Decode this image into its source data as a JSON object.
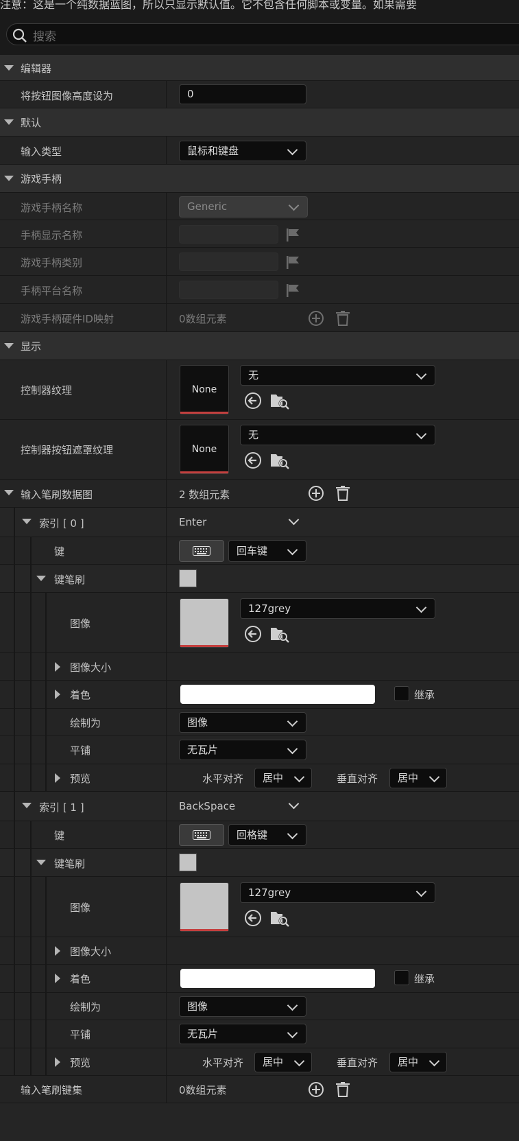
{
  "notice": "注意：这是一个纯数据蓝图，所以只显示默认值。它不包含任何脚本或变量。如果需要",
  "search": {
    "placeholder": "搜索"
  },
  "sections": {
    "editor": "编辑器",
    "default": "默认",
    "gamepad": "游戏手柄",
    "display": "显示"
  },
  "editor": {
    "label": "将按钮图像高度设为",
    "value": "0"
  },
  "default_section": {
    "label": "输入类型",
    "value": "鼠标和键盘"
  },
  "gamepad_section": {
    "name_label": "游戏手柄名称",
    "name_value": "Generic",
    "display_name_label": "手柄显示名称",
    "category_label": "游戏手柄类别",
    "platform_label": "手柄平台名称",
    "hw_id_label": "游戏手柄硬件ID映射",
    "hw_id_value": "0数组元素"
  },
  "display_section": {
    "controller_texture_label": "控制器纹理",
    "controller_texture_thumb": "None",
    "controller_texture_value": "无",
    "mask_texture_label": "控制器按钮遮罩纹理",
    "mask_texture_thumb": "None",
    "mask_texture_value": "无"
  },
  "brush_map": {
    "label": "输入笔刷数据图",
    "count": "2 数组元素"
  },
  "entries": [
    {
      "index_label": "索引 [ 0 ]",
      "key_value": "Enter",
      "key_label": "键",
      "key_name": "回车键",
      "brush_label": "键笔刷",
      "image_label": "图像",
      "image_value": "127grey",
      "image_size_label": "图像大小",
      "tint_label": "着色",
      "inherit_label": "继承",
      "draw_as_label": "绘制为",
      "draw_as_value": "图像",
      "tiling_label": "平铺",
      "tiling_value": "无瓦片",
      "preview_label": "预览",
      "h_align_label": "水平对齐",
      "h_align_value": "居中",
      "v_align_label": "垂直对齐",
      "v_align_value": "居中"
    },
    {
      "index_label": "索引 [ 1 ]",
      "key_value": "BackSpace",
      "key_label": "键",
      "key_name": "回格键",
      "brush_label": "键笔刷",
      "image_label": "图像",
      "image_value": "127grey",
      "image_size_label": "图像大小",
      "tint_label": "着色",
      "inherit_label": "继承",
      "draw_as_label": "绘制为",
      "draw_as_value": "图像",
      "tiling_label": "平铺",
      "tiling_value": "无瓦片",
      "preview_label": "预览",
      "h_align_label": "水平对齐",
      "h_align_value": "居中",
      "v_align_label": "垂直对齐",
      "v_align_value": "居中"
    }
  ],
  "key_set": {
    "label": "输入笔刷键集",
    "count": "0数组元素"
  },
  "colors": {
    "panel": "#242424",
    "category": "#2f2f2f",
    "input": "#0d0d0d",
    "accent_red": "#c4403f",
    "grey_swatch": "#c4c4c4"
  }
}
